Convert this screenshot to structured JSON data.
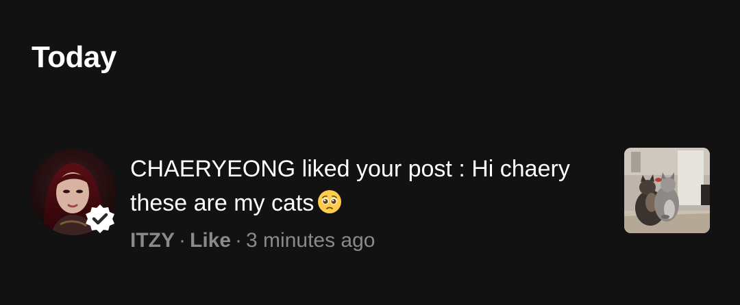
{
  "section": {
    "title": "Today"
  },
  "notification": {
    "message": "CHAERYEONG liked your post : Hi chaery these are my cats",
    "emoji": "pleading-face-emoji",
    "source": "ITZY",
    "separator": "·",
    "action": "Like",
    "time": "3 minutes ago",
    "avatar_icon": "artist-avatar",
    "badge_icon": "verified-badge-icon",
    "thumbnail": "cats-photo-thumbnail"
  },
  "colors": {
    "background": "#121212",
    "text_primary": "#ffffff",
    "text_secondary": "#8a8a8a"
  }
}
